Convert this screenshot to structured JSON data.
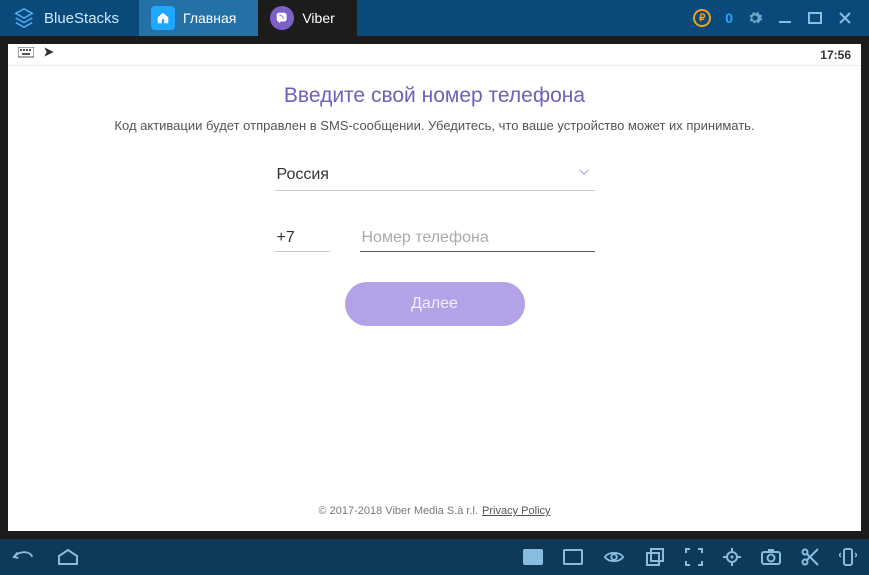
{
  "titlebar": {
    "brand": "BlueStacks",
    "coins": "0",
    "tabs": {
      "home": "Главная",
      "viber": "Viber"
    }
  },
  "statusbar": {
    "time": "17:56"
  },
  "screen": {
    "heading": "Введите свой номер телефона",
    "subheading": "Код активации будет отправлен в SMS-сообщении. Убедитесь, что ваше устройство может их принимать.",
    "country": "Россия",
    "country_code": "+7",
    "phone_placeholder": "Номер телефона",
    "next_label": "Далее"
  },
  "footer": {
    "copyright": "© 2017-2018 Viber Media S.à r.l.",
    "privacy": "Privacy Policy"
  }
}
